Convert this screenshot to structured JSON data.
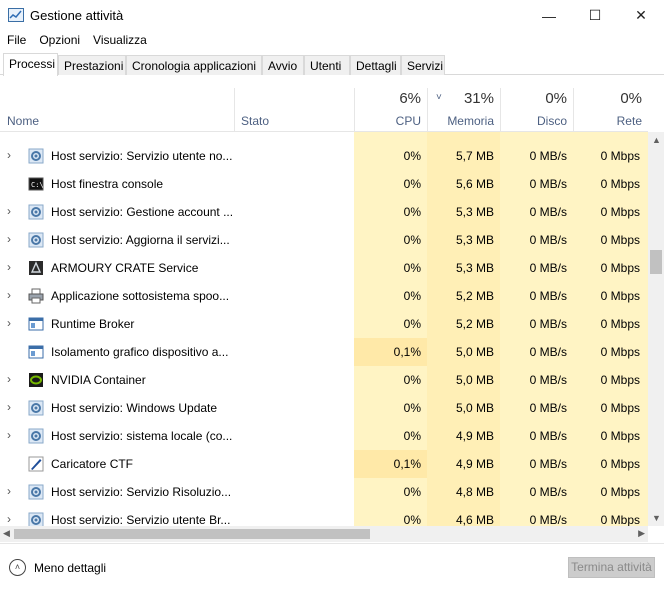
{
  "window": {
    "title": "Gestione attività",
    "minimize_glyph": "—",
    "maximize_glyph": "☐",
    "close_glyph": "✕"
  },
  "menu": [
    "File",
    "Opzioni",
    "Visualizza"
  ],
  "tabs": [
    {
      "label": "Processi",
      "active": true
    },
    {
      "label": "Prestazioni",
      "active": false
    },
    {
      "label": "Cronologia applicazioni",
      "active": false
    },
    {
      "label": "Avvio",
      "active": false
    },
    {
      "label": "Utenti",
      "active": false
    },
    {
      "label": "Dettagli",
      "active": false
    },
    {
      "label": "Servizi",
      "active": false
    }
  ],
  "columns": {
    "name": "Nome",
    "status": "Stato",
    "cpu": {
      "pct": "6%",
      "label": "CPU"
    },
    "memory": {
      "pct": "31%",
      "label": "Memoria",
      "sort_glyph": "˅"
    },
    "disk": {
      "pct": "0%",
      "label": "Disco"
    },
    "network": {
      "pct": "0%",
      "label": "Rete"
    }
  },
  "processes": [
    {
      "name": "Host servizio: Servizio utente no...",
      "icon": "gear-icon",
      "expandable": true,
      "cpu": "0%",
      "memory": "5,7 MB",
      "disk": "0 MB/s",
      "network": "0 Mbps",
      "cpu_highlight": false
    },
    {
      "name": "Host finestra console",
      "icon": "console-icon",
      "expandable": false,
      "cpu": "0%",
      "memory": "5,6 MB",
      "disk": "0 MB/s",
      "network": "0 Mbps",
      "cpu_highlight": false
    },
    {
      "name": "Host servizio: Gestione account ...",
      "icon": "gear-icon",
      "expandable": true,
      "cpu": "0%",
      "memory": "5,3 MB",
      "disk": "0 MB/s",
      "network": "0 Mbps",
      "cpu_highlight": false
    },
    {
      "name": "Host servizio: Aggiorna il servizi...",
      "icon": "gear-icon",
      "expandable": true,
      "cpu": "0%",
      "memory": "5,3 MB",
      "disk": "0 MB/s",
      "network": "0 Mbps",
      "cpu_highlight": false
    },
    {
      "name": "ARMOURY CRATE Service",
      "icon": "armoury-icon",
      "expandable": true,
      "cpu": "0%",
      "memory": "5,3 MB",
      "disk": "0 MB/s",
      "network": "0 Mbps",
      "cpu_highlight": false
    },
    {
      "name": "Applicazione sottosistema spoo...",
      "icon": "printer-icon",
      "expandable": true,
      "cpu": "0%",
      "memory": "5,2 MB",
      "disk": "0 MB/s",
      "network": "0 Mbps",
      "cpu_highlight": false
    },
    {
      "name": "Runtime Broker",
      "icon": "window-icon",
      "expandable": true,
      "cpu": "0%",
      "memory": "5,2 MB",
      "disk": "0 MB/s",
      "network": "0 Mbps",
      "cpu_highlight": false
    },
    {
      "name": "Isolamento grafico dispositivo a...",
      "icon": "window-icon",
      "expandable": false,
      "cpu": "0,1%",
      "memory": "5,0 MB",
      "disk": "0 MB/s",
      "network": "0 Mbps",
      "cpu_highlight": true
    },
    {
      "name": "NVIDIA Container",
      "icon": "nvidia-icon",
      "expandable": true,
      "cpu": "0%",
      "memory": "5,0 MB",
      "disk": "0 MB/s",
      "network": "0 Mbps",
      "cpu_highlight": false
    },
    {
      "name": "Host servizio: Windows Update",
      "icon": "gear-icon",
      "expandable": true,
      "cpu": "0%",
      "memory": "5,0 MB",
      "disk": "0 MB/s",
      "network": "0 Mbps",
      "cpu_highlight": false
    },
    {
      "name": "Host servizio: sistema locale (co...",
      "icon": "gear-icon",
      "expandable": true,
      "cpu": "0%",
      "memory": "4,9 MB",
      "disk": "0 MB/s",
      "network": "0 Mbps",
      "cpu_highlight": false
    },
    {
      "name": "Caricatore CTF",
      "icon": "pen-icon",
      "expandable": false,
      "cpu": "0,1%",
      "memory": "4,9 MB",
      "disk": "0 MB/s",
      "network": "0 Mbps",
      "cpu_highlight": true
    },
    {
      "name": "Host servizio: Servizio Risoluzio...",
      "icon": "gear-icon",
      "expandable": true,
      "cpu": "0%",
      "memory": "4,8 MB",
      "disk": "0 MB/s",
      "network": "0 Mbps",
      "cpu_highlight": false
    },
    {
      "name": "Host servizio: Servizio utente Br...",
      "icon": "gear-icon",
      "expandable": true,
      "cpu": "0%",
      "memory": "4,6 MB",
      "disk": "0 MB/s",
      "network": "0 Mbps",
      "cpu_highlight": false
    }
  ],
  "footer": {
    "less_details": "Meno dettagli",
    "end_task": "Termina attività"
  }
}
